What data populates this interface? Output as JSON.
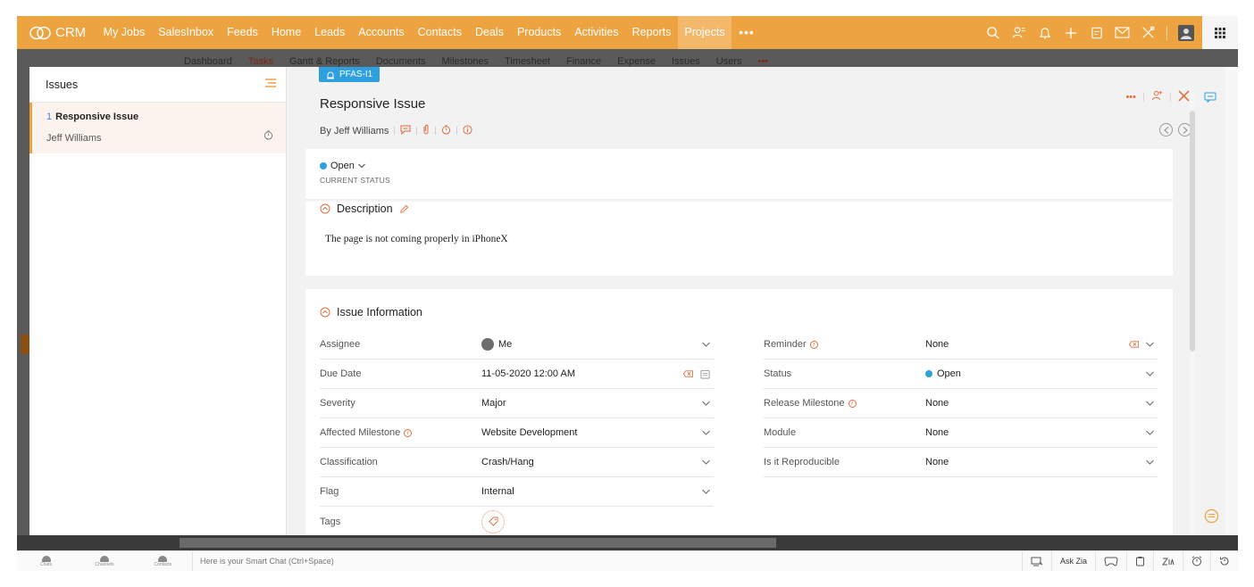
{
  "topnav": {
    "logo": "CRM",
    "items": [
      "My Jobs",
      "SalesInbox",
      "Feeds",
      "Home",
      "Leads",
      "Accounts",
      "Contacts",
      "Deals",
      "Products",
      "Activities",
      "Reports",
      "Projects"
    ],
    "active": "Projects",
    "more": "•••"
  },
  "background": {
    "subnav": [
      "Dashboard",
      "Tasks",
      "Gantt & Reports",
      "Documents",
      "Milestones",
      "Timesheet",
      "Finance",
      "Expense",
      "Issues",
      "Users",
      "•••"
    ]
  },
  "leftpanel": {
    "title": "Issues",
    "items": [
      {
        "number": "1",
        "title": "Responsive Issue",
        "owner": "Jeff Williams"
      }
    ]
  },
  "issue": {
    "tag": "PFAS-I1",
    "title": "Responsive Issue",
    "by": "By Jeff Williams",
    "actions_more": "•••",
    "status_value": "Open",
    "status_caption": "CURRENT STATUS",
    "description_heading": "Description",
    "description_text": "The page is not coming properly in iPhoneX",
    "info_heading": "Issue Information"
  },
  "fields_left": [
    {
      "label": "Assignee",
      "value": "Me"
    },
    {
      "label": "Due Date",
      "value": "11-05-2020 12:00 AM"
    },
    {
      "label": "Severity",
      "value": "Major"
    },
    {
      "label": "Affected Milestone",
      "value": "Website Development"
    },
    {
      "label": "Classification",
      "value": "Crash/Hang"
    },
    {
      "label": "Flag",
      "value": "Internal"
    },
    {
      "label": "Tags",
      "value": ""
    }
  ],
  "fields_right": [
    {
      "label": "Reminder",
      "value": "None"
    },
    {
      "label": "Status",
      "value": "Open"
    },
    {
      "label": "Release Milestone",
      "value": "None"
    },
    {
      "label": "Module",
      "value": "None"
    },
    {
      "label": "Is it Reproducible",
      "value": "None"
    }
  ],
  "bottombar": {
    "left": [
      "Chats",
      "Channels",
      "Contacts"
    ],
    "smartchat_placeholder": "Here is your Smart Chat (Ctrl+Space)",
    "askzia": "Ask Zia"
  },
  "colors": {
    "accent": "#eda33f",
    "blue": "#2ea0e0",
    "orange_icon": "#e06b3a"
  }
}
